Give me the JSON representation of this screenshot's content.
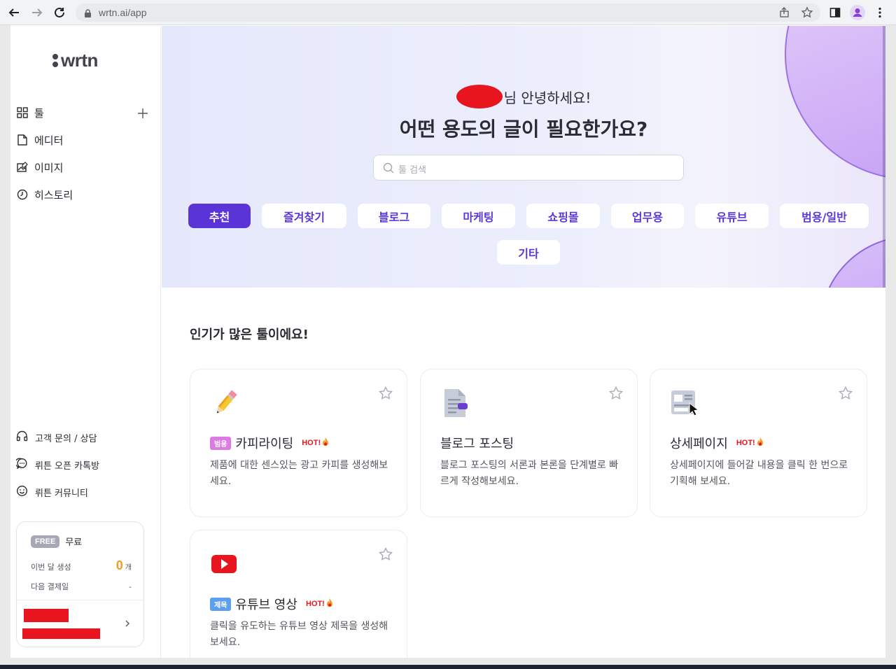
{
  "browser": {
    "url": "wrtn.ai/app"
  },
  "sidebar": {
    "logo": "wrtn",
    "nav": [
      {
        "label": "툴",
        "icon": "grid-icon"
      },
      {
        "label": "에디터",
        "icon": "document-icon"
      },
      {
        "label": "이미지",
        "icon": "image-icon"
      },
      {
        "label": "히스토리",
        "icon": "clock-icon"
      }
    ],
    "help": [
      {
        "label": "고객 문의 / 상담",
        "icon": "headset-icon"
      },
      {
        "label": "뤼튼 오픈 카톡방",
        "icon": "chat-icon"
      },
      {
        "label": "뤼튼 커뮤니티",
        "icon": "smile-icon"
      }
    ],
    "plan": {
      "badge": "FREE",
      "name": "무료",
      "usage_label": "이번 달 생성",
      "usage_count": "0",
      "usage_unit": "개",
      "next_payment_label": "다음 결제일",
      "next_payment_value": "-"
    }
  },
  "hero": {
    "greeting": "님 안녕하세요!",
    "title": "어떤 용도의 글이 필요한가요?",
    "search_placeholder": "툴 검색",
    "categories": [
      "추천",
      "즐겨찾기",
      "블로그",
      "마케팅",
      "쇼핑몰",
      "업무용",
      "유튜브",
      "범용/일반",
      "기타"
    ],
    "active_category": "추천"
  },
  "main": {
    "section_title": "인기가 많은 툴이에요!",
    "cards": [
      {
        "title": "카피라이팅",
        "tag": "범용",
        "tag_color": "#de7be3",
        "hot": "HOT!",
        "desc": "제품에 대한 센스있는 광고 카피를 생성해보세요.",
        "icon": "pencil-icon"
      },
      {
        "title": "블로그 포스팅",
        "tag": "",
        "tag_color": "",
        "hot": "",
        "desc": "블로그 포스팅의 서론과 본론을 단계별로 빠르게 작성해보세요.",
        "icon": "blog-doc-icon"
      },
      {
        "title": "상세페이지",
        "tag": "",
        "tag_color": "",
        "hot": "HOT!",
        "desc": "상세페이지에 들어갈 내용을 클릭 한 번으로 기획해 보세요.",
        "icon": "detail-page-icon"
      },
      {
        "title": "유튜브 영상",
        "tag": "제목",
        "tag_color": "#5c9ff0",
        "hot": "HOT!",
        "desc": "클릭을 유도하는 유튜브 영상 제목을 생성해보세요.",
        "icon": "youtube-icon"
      }
    ]
  },
  "colors": {
    "accent": "#5a34d6",
    "hot": "#e8141e",
    "count": "#f59b23"
  }
}
